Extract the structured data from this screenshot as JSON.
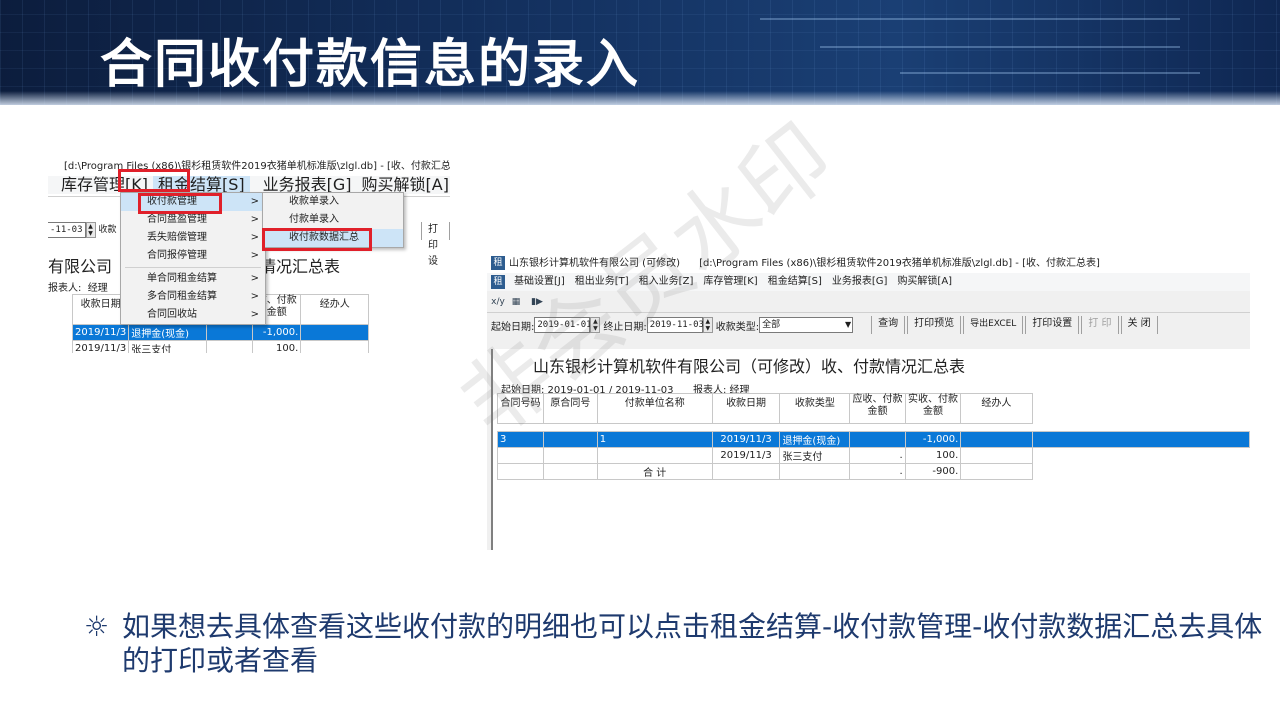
{
  "slide": {
    "title": "合同收付款信息的录入",
    "bullet_symbol": "☼",
    "bullet_text": "如果想去具体查看这些收付款的明细也可以点击租金结算-收付款管理-收付款数据汇总去具体的打印或者查看",
    "watermark": "非会员水印"
  },
  "crop": {
    "titlebar": "[d:\\Program Files (x86)\\银杉租赁软件2019衣猪单机标准版\\zlgl.db] - [收、付款汇总表",
    "menu": [
      "库存管理[K]",
      "租金结算[S]",
      "业务报表[G]",
      "购买解锁[A]"
    ],
    "date_end": "-11-03",
    "filter_label_partial": "收款",
    "print_btn_partial": "打印设",
    "report_title_partial": "有限公司（",
    "report_title_tail": "情况汇总表",
    "reporter_label": "报表人:",
    "reporter_value": "经理",
    "headers": [
      "收款日期",
      "收、付款\n金额",
      "经办人"
    ],
    "rows": [
      {
        "date": "2019/11/3",
        "type": "退押金(现金)",
        "amount": "-1,000."
      },
      {
        "date": "2019/11/3",
        "type": "张三支付",
        "amount": "100."
      }
    ],
    "submenu": [
      {
        "label": "收付款管理",
        "arrow": ">"
      },
      {
        "label": "合同盘盈管理",
        "arrow": ">"
      },
      {
        "label": "丢失赔偿管理",
        "arrow": ">"
      },
      {
        "label": "合同报停管理",
        "arrow": ">"
      },
      {
        "label": "单合同租金结算",
        "arrow": ">"
      },
      {
        "label": "多合同租金结算",
        "arrow": ">"
      },
      {
        "label": "合同回收站",
        "arrow": ">"
      }
    ],
    "subsubmenu": [
      "收款单录入",
      "付款单录入",
      "收付款数据汇总"
    ]
  },
  "app": {
    "titlebar_company": "山东银杉计算机软件有限公司 (可修改)",
    "titlebar_path": "[d:\\Program Files (x86)\\银杉租赁软件2019衣猪单机标准版\\zlgl.db] - [收、付款汇总表]",
    "menu": [
      "基础设置[J]",
      "租出业务[T]",
      "租入业务[Z]",
      "库存管理[K]",
      "租金结算[S]",
      "业务报表[G]",
      "购买解锁[A]"
    ],
    "toolbar_icons": [
      "x/y-icon",
      "table-icon",
      "exit-icon"
    ],
    "toolbar_glyphs": [
      "x/y",
      "▦",
      "▮▶"
    ],
    "filter": {
      "start_label": "起始日期:",
      "start_value": "2019-01-01",
      "end_label": "终止日期:",
      "end_value": "2019-11-03",
      "type_label": "收款类型:",
      "type_value": "全部"
    },
    "buttons": [
      {
        "label": "查询",
        "disabled": false
      },
      {
        "label": "打印预览",
        "disabled": false
      },
      {
        "label": "导出EXCEL",
        "disabled": false
      },
      {
        "label": "打印设置",
        "disabled": false
      },
      {
        "label": "打 印",
        "disabled": true
      },
      {
        "label": "关 闭",
        "disabled": false
      }
    ],
    "report": {
      "title": "山东银杉计算机软件有限公司（可修改）收、付款情况汇总表",
      "date_range": "起始日期: 2019-01-01 / 2019-11-03",
      "reporter": "报表人:    经理",
      "headers": [
        "合同号码",
        "原合同号",
        "付款单位名称",
        "收款日期",
        "收款类型",
        "应收、付款\n金额",
        "实收、付款\n金额",
        "经办人"
      ],
      "rows": [
        [
          "3",
          "",
          "1",
          "2019/11/3",
          "退押金(现金)",
          "",
          "-1,000.",
          ""
        ],
        [
          "",
          "",
          "",
          "2019/11/3",
          "张三支付",
          ".",
          "100.",
          ""
        ],
        [
          "",
          "",
          "合    计",
          "",
          "",
          ".",
          "-900.",
          ""
        ]
      ]
    }
  }
}
